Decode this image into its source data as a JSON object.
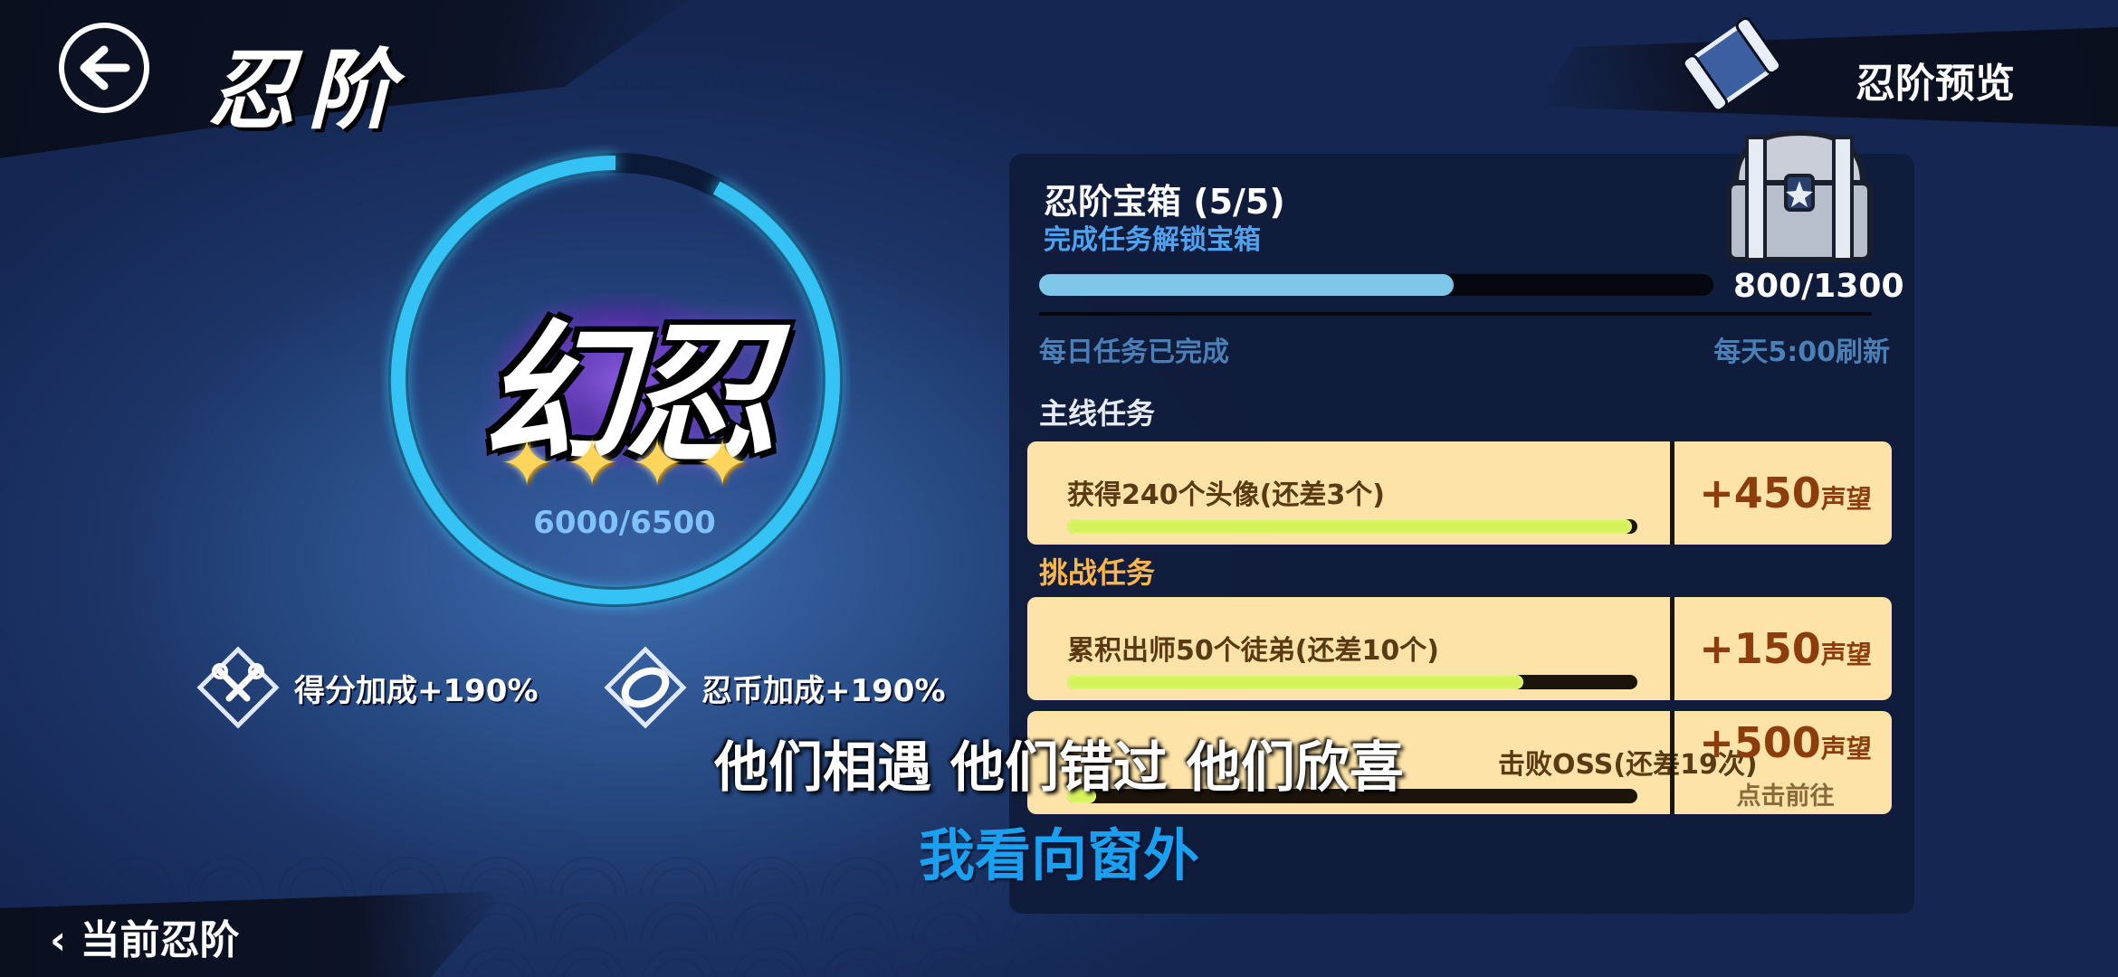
{
  "header": {
    "title": "忍阶",
    "preview_label": "忍阶预览"
  },
  "rank": {
    "name": "幻忍",
    "stars": 4,
    "score": "6000/6500",
    "progress": 0.923
  },
  "bonuses": [
    {
      "icon": "kunai-icon",
      "label": "得分加成+190%"
    },
    {
      "icon": "coin-icon",
      "label": "忍币加成+190%"
    }
  ],
  "chest": {
    "title": "忍阶宝箱 (5/5)",
    "subtitle": "完成任务解锁宝箱",
    "count": "800/1300",
    "progress": 0.615,
    "daily_status": "每日任务已完成",
    "refresh": "每天5:00刷新"
  },
  "sections": {
    "main": "主线任务",
    "challenge": "挑战任务"
  },
  "tasks": [
    {
      "name": "获得240个头像(还差3个)",
      "progress": 0.99,
      "reward": "+450",
      "unit": "声望",
      "action": ""
    },
    {
      "name": "累积出师50个徒弟(还差10个)",
      "progress": 0.8,
      "reward": "+150",
      "unit": "声望",
      "action": ""
    },
    {
      "name": "击败OSS(还差19次)",
      "progress": 0.05,
      "reward": "+500",
      "unit": "声望",
      "action": "点击前往"
    }
  ],
  "footer": {
    "current_label": "当前忍阶"
  },
  "subtitles": {
    "line1": "他们相遇 他们错过 他们欣喜",
    "line2": "我看向窗外"
  },
  "colors": {
    "ring": "#36c3f5",
    "task_bg": "#fee3a8",
    "reward": "#8c3d0e",
    "bar_fill": "#d6f25a",
    "subtitle_blue": "#1aa0f0"
  }
}
